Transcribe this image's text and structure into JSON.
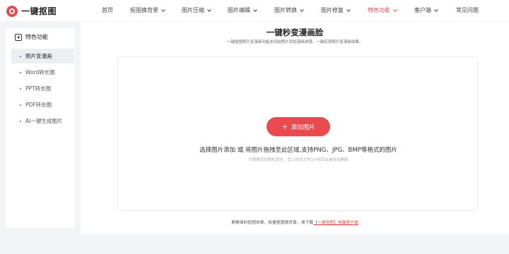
{
  "header": {
    "logo_text": "一键抠图",
    "nav": [
      {
        "label": "首页",
        "dropdown": false,
        "active": false
      },
      {
        "label": "抠图换背景",
        "dropdown": true,
        "active": false
      },
      {
        "label": "图片压缩",
        "dropdown": true,
        "active": false
      },
      {
        "label": "图片编辑",
        "dropdown": true,
        "active": false
      },
      {
        "label": "图片转换",
        "dropdown": true,
        "active": false
      },
      {
        "label": "图片修复",
        "dropdown": true,
        "active": false
      },
      {
        "label": "特色功能",
        "dropdown": true,
        "active": true
      },
      {
        "label": "客户端",
        "dropdown": true,
        "active": false
      },
      {
        "label": "常见问题",
        "dropdown": false,
        "active": false
      }
    ]
  },
  "sidebar": {
    "title": "特色功能",
    "items": [
      {
        "label": "照片变漫画",
        "active": true
      },
      {
        "label": "Word转长图",
        "active": false
      },
      {
        "label": "PPT转长图",
        "active": false
      },
      {
        "label": "PDF转长图",
        "active": false
      },
      {
        "label": "AI一键生成图片",
        "active": false
      }
    ]
  },
  "main": {
    "title": "一键秒变漫画脸",
    "subtitle": "一键抠图照片变漫画功能支持给照片添加漫画滤镜，一键实现照片变漫画效果。",
    "add_button": "添加图片",
    "drop_text": "选择图片添加 或 将图片拖拽至此区域,支持PNG、JPG、BMP等格式的图片",
    "privacy_note": "为保障您的隐私安全，您上传的文件1小时后会被自动删除",
    "footer_prefix": "更精准的抠图效果，批量抠图换背景，请下载",
    "footer_link": "【一键抠图】电脑客户端"
  },
  "colors": {
    "accent": "#e84a4f",
    "page_bg": "#f3f4f6"
  }
}
